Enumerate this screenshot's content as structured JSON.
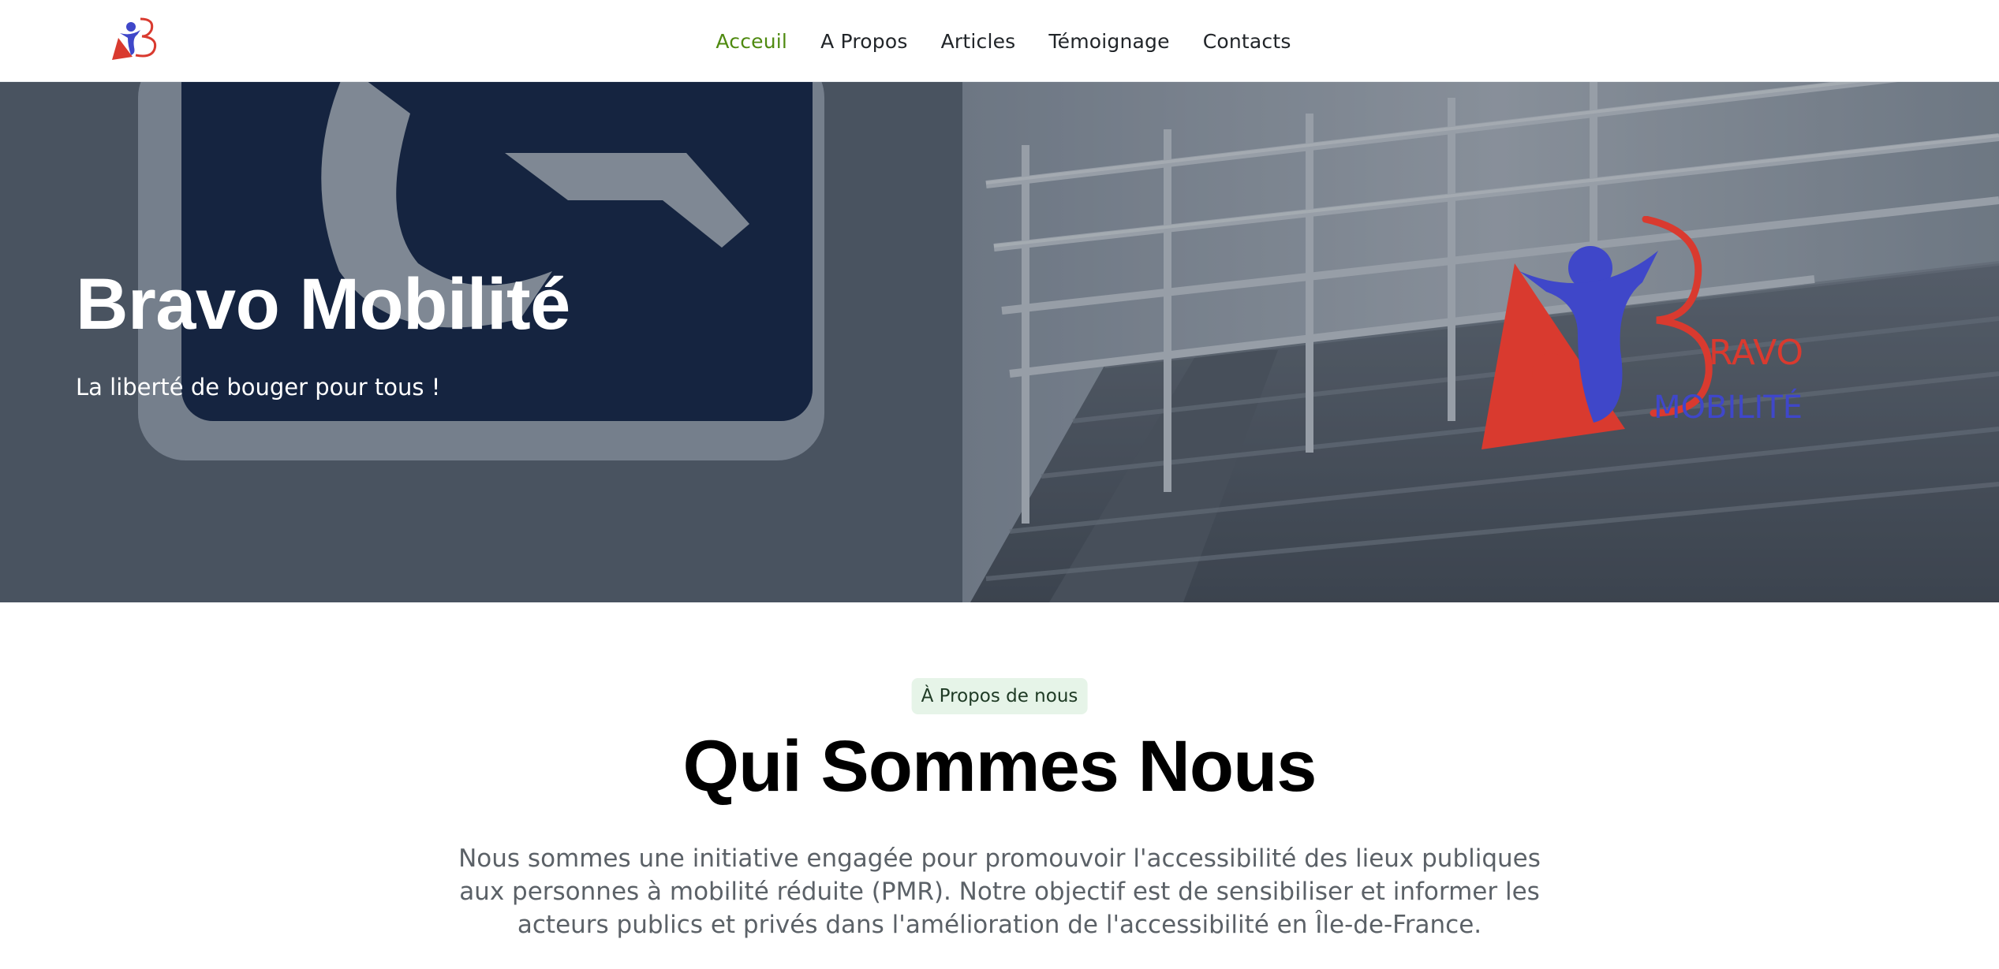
{
  "navbar": {
    "logo_icon": "bravo-mobilite-logo",
    "links": [
      {
        "label": "Acceuil",
        "active": true
      },
      {
        "label": "A Propos",
        "active": false
      },
      {
        "label": "Articles",
        "active": false
      },
      {
        "label": "Témoignage",
        "active": false
      },
      {
        "label": "Contacts",
        "active": false
      }
    ],
    "active_color": "#4f8a10"
  },
  "hero": {
    "title": "Bravo Mobilité",
    "subtitle": "La liberté de bouger pour tous !",
    "logo": {
      "line1": "RAVO",
      "line2": "MOBILITÉ"
    },
    "background_image": "accessibility-ramp-with-handrails-and-wheelchair-sign"
  },
  "about": {
    "badge": "À Propos de nous",
    "title": "Qui Sommes Nous",
    "text": "Nous sommes une initiative engagée pour promouvoir l'accessibilité des lieux publiques aux personnes à mobilité réduite (PMR). Notre objectif est de sensibiliser et informer les acteurs publics et privés dans l'amélioration de l'accessibilité en Île-de-France."
  },
  "colors": {
    "brand_red": "#d93a2f",
    "brand_blue": "#3f47c9",
    "badge_bg": "#e6f4e8"
  }
}
